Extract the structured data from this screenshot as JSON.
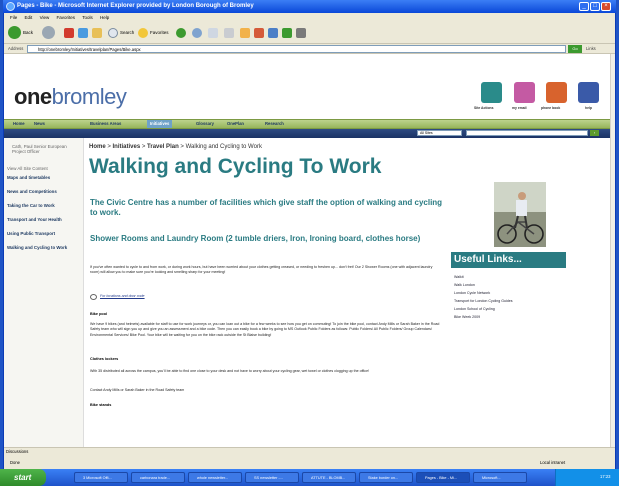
{
  "window": {
    "title": "Pages - Bike - Microsoft Internet Explorer provided by London Borough of Bromley"
  },
  "menu": [
    "File",
    "Edit",
    "View",
    "Favorites",
    "Tools",
    "Help"
  ],
  "toolbar": {
    "back": "Back",
    "search": "Search",
    "favorites": "Favorites"
  },
  "address": {
    "label": "Address",
    "url": "http://onebromley/Initiatives/travelplan/Pages/Bike.aspx",
    "go": "Go",
    "links": "Links"
  },
  "site": {
    "logo_bold": "one",
    "logo_light": "bromley",
    "tiles": [
      {
        "label": "Site Actions",
        "color": "#2a8b8a"
      },
      {
        "label": "my email",
        "color": "#c45aa3"
      },
      {
        "label": "phone book",
        "color": "#d8632d"
      },
      {
        "label": "help",
        "color": "#3a5aa8"
      }
    ]
  },
  "nav": {
    "items": [
      "Home",
      "News",
      "Business Areas",
      "Initiatives",
      "Glossary",
      "OnePlan",
      "Research"
    ]
  },
  "search": {
    "scope": "All Sites"
  },
  "sidebar": {
    "person": "Cath, Paul Senior European Project Officer",
    "view_all": "View All Site Content",
    "items": [
      "Maps and timetables",
      "News and Competitions",
      "Taking the Car to Work",
      "Transport and Your Health",
      "Using Public Transport",
      "Walking and Cycling to Work"
    ]
  },
  "main": {
    "breadcrumb_home": "Home",
    "breadcrumb_initiatives": "Initiatives",
    "breadcrumb_travel": "Travel Plan",
    "breadcrumb_current": "Walking and Cycling to Work",
    "title": "Walking and Cycling To Work",
    "intro": "The Civic Centre has a number of facilities which give staff the option of walking and cycling to work.",
    "shower_heading": "Shower Rooms and Laundry Room (2 tumble driers, Iron, Ironing board, clothes horse)",
    "para1": "If you've often wanted to cycle to and from work, or during work hours, but have been worried about your clothes getting creased, or needing to freshen up... don't fret! Our 2 Shower Rooms (one with adjacent laundry room) will allow you to make sure you're looking and smelling sharp for your meeting!",
    "locations_link": "For locations and door code",
    "bike_pool": "Bike pool",
    "para2": "We have 9 bikes (and helmets) available for staff to use for work journeys or, you can loan out a bike for a few weeks to see how you get on commuting! To join the bike pool, contact Andy Mills or Sarah Baker in the Road Safety team who will sign you up and give you an assessment and a bike code. Then you can easily book a bike by going to MS Outlook Public Folders as follows: Public Folders/ All Public Folders/ Group Calendars/ Environmental Services/ Bike Pool. Your bike will be waiting for you on the bike rack outside the St Blaise building!",
    "clothes_lockers": "Clothes lockers",
    "para3": "With 35 distributed all across the campus, you'll be able to find one close to your desk and not have to worry about your cycling gear, wet towel or clothes clogging up the office!",
    "para4": "Contact Andy Mills or Sarah Baker in the Road Safety team",
    "bike_stands": "Bike stands"
  },
  "useful": {
    "title": "Useful Links...",
    "links": [
      "Walkit",
      "Walk London",
      "London Cycle Network",
      "Transport for London Cycling Guides",
      "London School of Cycling",
      "Bike Week 2009"
    ]
  },
  "status": {
    "discussions": "Discussions",
    "done": "Done",
    "zone": "Local intranet"
  },
  "taskbar": {
    "start": "start",
    "tasks": [
      "3 Microsoft Offi...",
      "carbonara trade...",
      "whole newsletter...",
      "SS newsletter -...",
      "ATTUTE - BLOMB...",
      "Stake border on...",
      "Pages - Bike - Mi...",
      "Microsoft..."
    ],
    "active_index": 6,
    "clock": "17:23"
  }
}
